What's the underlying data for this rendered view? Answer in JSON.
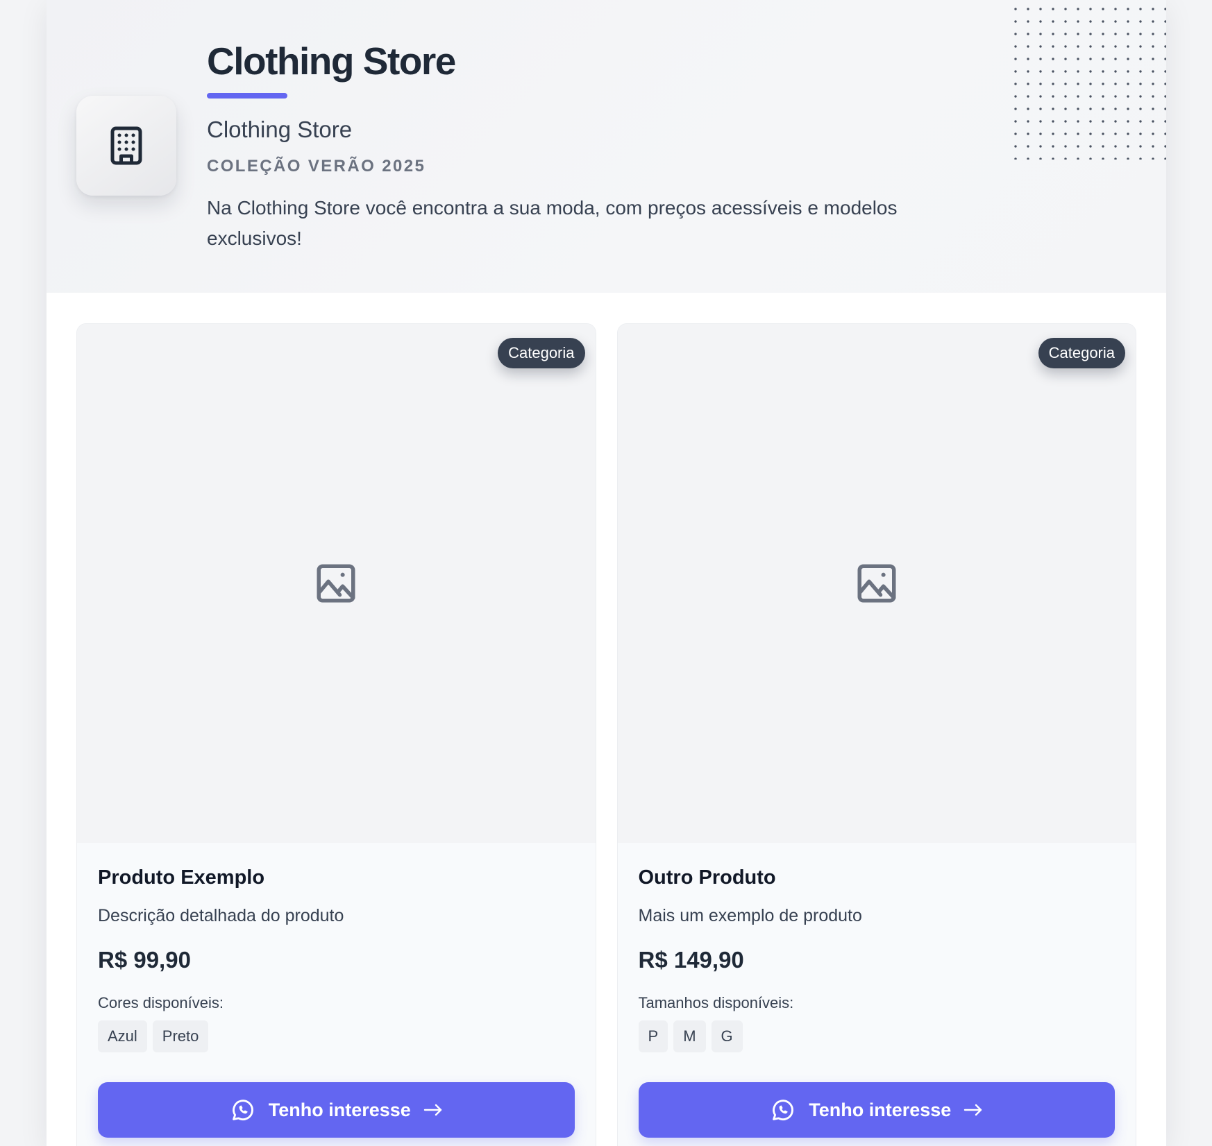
{
  "header": {
    "title": "Clothing Store",
    "subtitle": "Clothing Store",
    "collection": "COLEÇÃO VERÃO 2025",
    "description": "Na Clothing Store você encontra a sua moda, com preços acessíveis e modelos exclusivos!",
    "logo_icon": "building-icon",
    "accent_color": "#6366f1"
  },
  "products": [
    {
      "badge": "Categoria",
      "image_icon": "image-placeholder-icon",
      "name": "Produto Exemplo",
      "description": "Descrição detalhada do produto",
      "price": "R$ 99,90",
      "options_label": "Cores disponíveis:",
      "options": [
        "Azul",
        "Preto"
      ],
      "cta_label": "Tenho interesse",
      "cta_icon": "whatsapp-icon"
    },
    {
      "badge": "Categoria",
      "image_icon": "image-placeholder-icon",
      "name": "Outro Produto",
      "description": "Mais um exemplo de produto",
      "price": "R$ 149,90",
      "options_label": "Tamanhos disponíveis:",
      "options": [
        "P",
        "M",
        "G"
      ],
      "cta_label": "Tenho interesse",
      "cta_icon": "whatsapp-icon"
    }
  ]
}
